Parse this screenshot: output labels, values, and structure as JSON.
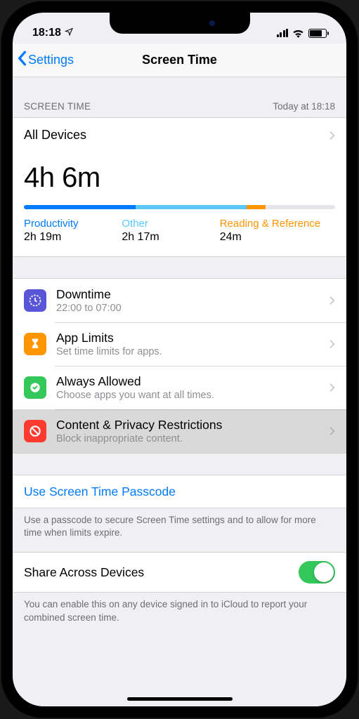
{
  "status": {
    "time": "18:18",
    "location_icon": "location-arrow"
  },
  "nav": {
    "back_label": "Settings",
    "title": "Screen Time"
  },
  "summary": {
    "section_label": "SCREEN TIME",
    "timestamp": "Today at 18:18",
    "all_devices_label": "All Devices",
    "total_time": "4h 6m",
    "categories": [
      {
        "label": "Productivity",
        "time": "2h 19m",
        "color": "blue",
        "fraction": 0.36
      },
      {
        "label": "Other",
        "time": "2h 17m",
        "color": "lightblue",
        "fraction": 0.355
      },
      {
        "label": "Reading & Reference",
        "time": "24m",
        "color": "orange",
        "fraction": 0.062
      }
    ]
  },
  "options": [
    {
      "icon": "downtime",
      "color": "purple",
      "title": "Downtime",
      "subtitle": "22:00 to 07:00"
    },
    {
      "icon": "hourglass",
      "color": "orange",
      "title": "App Limits",
      "subtitle": "Set time limits for apps."
    },
    {
      "icon": "check-badge",
      "color": "green",
      "title": "Always Allowed",
      "subtitle": "Choose apps you want at all times."
    },
    {
      "icon": "no-entry",
      "color": "red",
      "title": "Content & Privacy Restrictions",
      "subtitle": "Block inappropriate content.",
      "pressed": true
    }
  ],
  "passcode": {
    "link_label": "Use Screen Time Passcode",
    "note": "Use a passcode to secure Screen Time settings and to allow for more time when limits expire."
  },
  "share": {
    "label": "Share Across Devices",
    "enabled": true,
    "note": "You can enable this on any device signed in to iCloud to report your combined screen time."
  }
}
